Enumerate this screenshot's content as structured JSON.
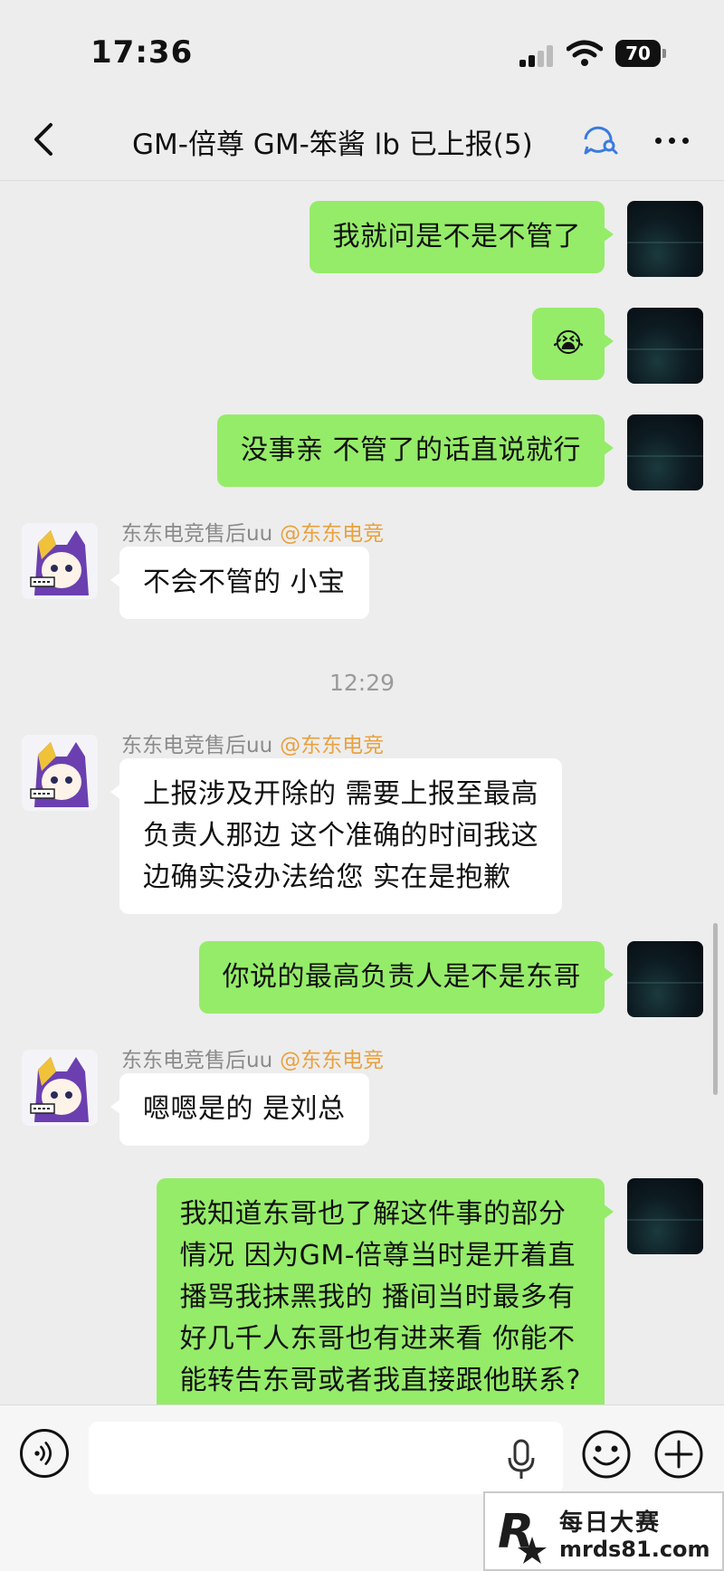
{
  "status_bar": {
    "time": "17:36",
    "battery": "70"
  },
  "nav": {
    "title": "GM-倍尊 GM-笨酱  lb 已上报(5)"
  },
  "messages": {
    "m1": "我就问是不是不管了",
    "m2": "😭",
    "m3": "没事亲 不管了的话直说就行",
    "m4_sender": "东东电竞售后uu",
    "m4_tag": "@东东电竞",
    "m4": "不会不管的 小宝",
    "timestamp": "12:29",
    "m5_sender": "东东电竞售后uu",
    "m5_tag": "@东东电竞",
    "m5": "上报涉及开除的 需要上报至最高\n负责人那边 这个准确的时间我这\n边确实没办法给您 实在是抱歉",
    "m6": "你说的最高负责人是不是东哥",
    "m7_sender": "东东电竞售后uu",
    "m7_tag": "@东东电竞",
    "m7": "嗯嗯是的 是刘总",
    "m8": "我知道东哥也了解这件事的部分\n情况 因为GM-倍尊当时是开着直\n播骂我抹黑我的 播间当时最多有\n好几千人东哥也有进来看 你能不\n能转告东哥或者我直接跟他联系?\n他所了解的情况都是从倍尊那得"
  },
  "input": {
    "value": ""
  },
  "watermark": {
    "line1": "每日大赛",
    "line2": "mrds81.com",
    "logo_text": "R"
  },
  "colors": {
    "my_bubble": "#95ec69",
    "their_bubble": "#ffffff",
    "background": "#ededed",
    "sender_tag": "#e9a13d"
  },
  "icons": [
    "back-icon",
    "chat-search-icon",
    "more-icon",
    "voice-icon",
    "mic-icon",
    "emoji-icon",
    "plus-icon"
  ]
}
